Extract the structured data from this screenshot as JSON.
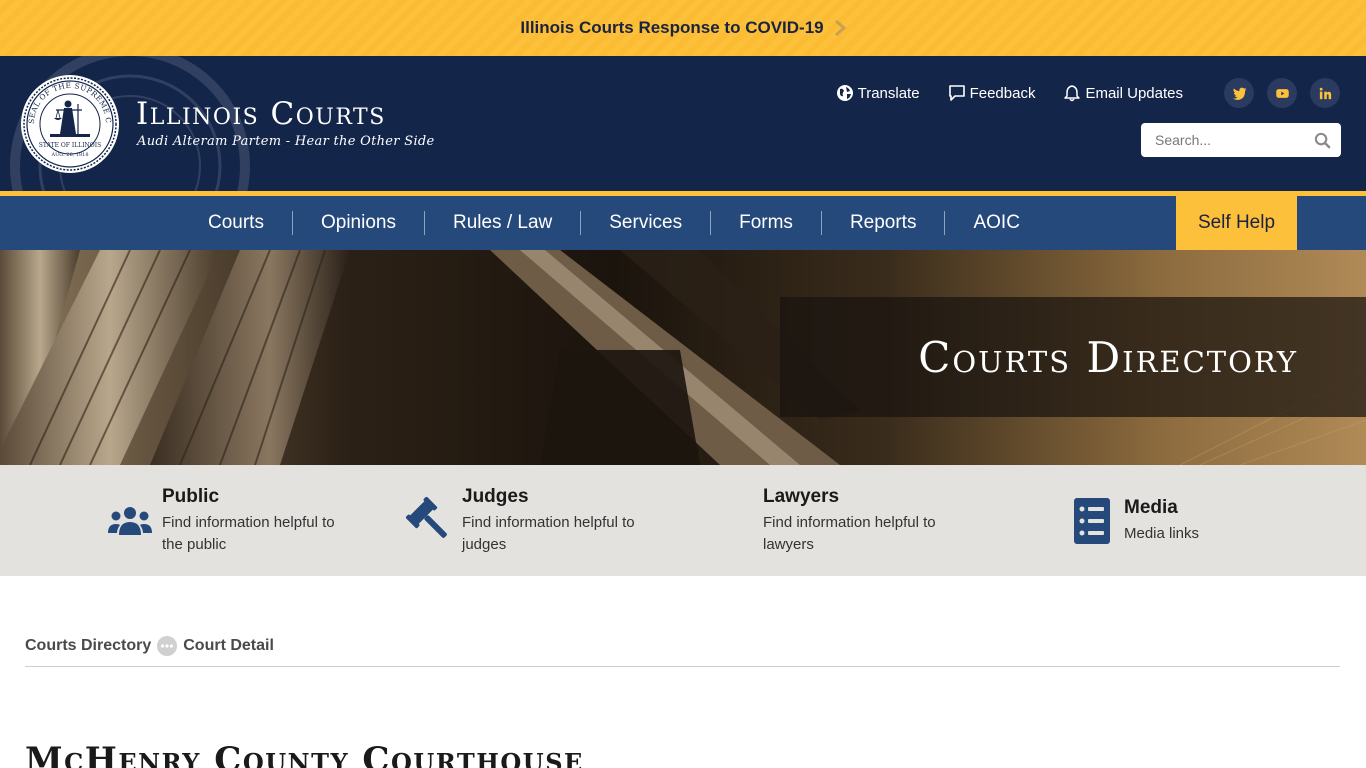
{
  "alert": {
    "label": "Illinois Courts Response to COVID-19",
    "background": "#fcc03a"
  },
  "header": {
    "title": "Illinois Courts",
    "subtitle": "Audi Alteram Partem - Hear the Other Side",
    "background": "#14254a",
    "seal_text": {
      "ring": "SEAL OF THE SUPREME COURT",
      "state": "STATE OF ILLINOIS",
      "date": "AUG. 26, 1818"
    },
    "util_links": [
      {
        "label": "Translate",
        "icon": "globe-icon"
      },
      {
        "label": "Feedback",
        "icon": "chat-bubble-icon"
      },
      {
        "label": "Email Updates",
        "icon": "bell-icon"
      }
    ],
    "social": [
      {
        "name": "twitter",
        "icon": "twitter-icon"
      },
      {
        "name": "youtube",
        "icon": "youtube-icon"
      },
      {
        "name": "linkedin",
        "icon": "linkedin-icon"
      }
    ],
    "search": {
      "placeholder": "Search..."
    }
  },
  "nav": {
    "items": [
      {
        "label": "Courts"
      },
      {
        "label": "Opinions"
      },
      {
        "label": "Rules / Law"
      },
      {
        "label": "Services"
      },
      {
        "label": "Forms"
      },
      {
        "label": "Reports"
      },
      {
        "label": "AOIC"
      }
    ],
    "self_help": "Self Help",
    "background": "#25497a",
    "accent": "#fcc03a"
  },
  "hero": {
    "title": "Courts Directory"
  },
  "audience": [
    {
      "title": "Public",
      "desc": "Find information helpful to the public",
      "icon": "people-group-icon"
    },
    {
      "title": "Judges",
      "desc": "Find information helpful to judges",
      "icon": "gavel-icon"
    },
    {
      "title": "Lawyers",
      "desc": "Find information helpful to lawyers",
      "icon": ""
    },
    {
      "title": "Media",
      "desc": "Media links",
      "icon": "list-document-icon"
    }
  ],
  "breadcrumb": {
    "items": [
      "Courts Directory",
      "Court Detail"
    ]
  },
  "page": {
    "title": "McHenry County Courthouse"
  }
}
